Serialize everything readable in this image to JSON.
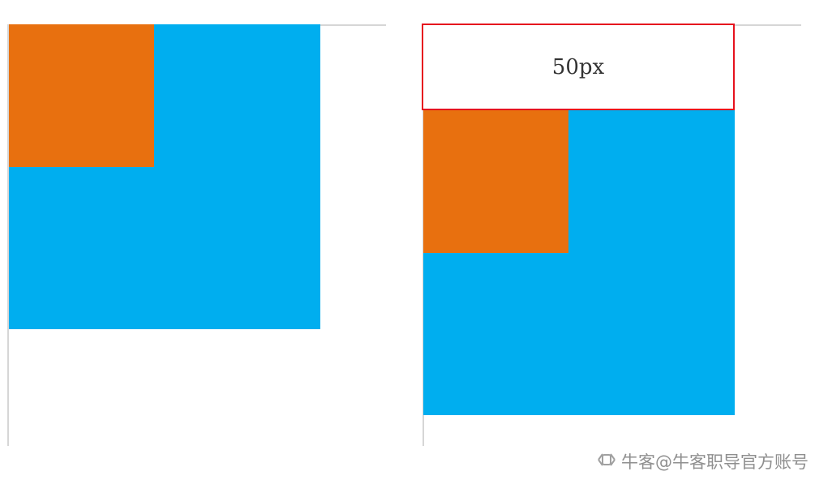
{
  "diagram": {
    "offset_label": "50px",
    "colors": {
      "outer_box": "#00aeef",
      "inner_box": "#e8700f",
      "highlight_border": "#e6121e",
      "guide_line": "#d6d6d6"
    }
  },
  "watermark": {
    "text": "牛客@牛客职导官方账号",
    "icon": "niuke-logo-icon"
  }
}
